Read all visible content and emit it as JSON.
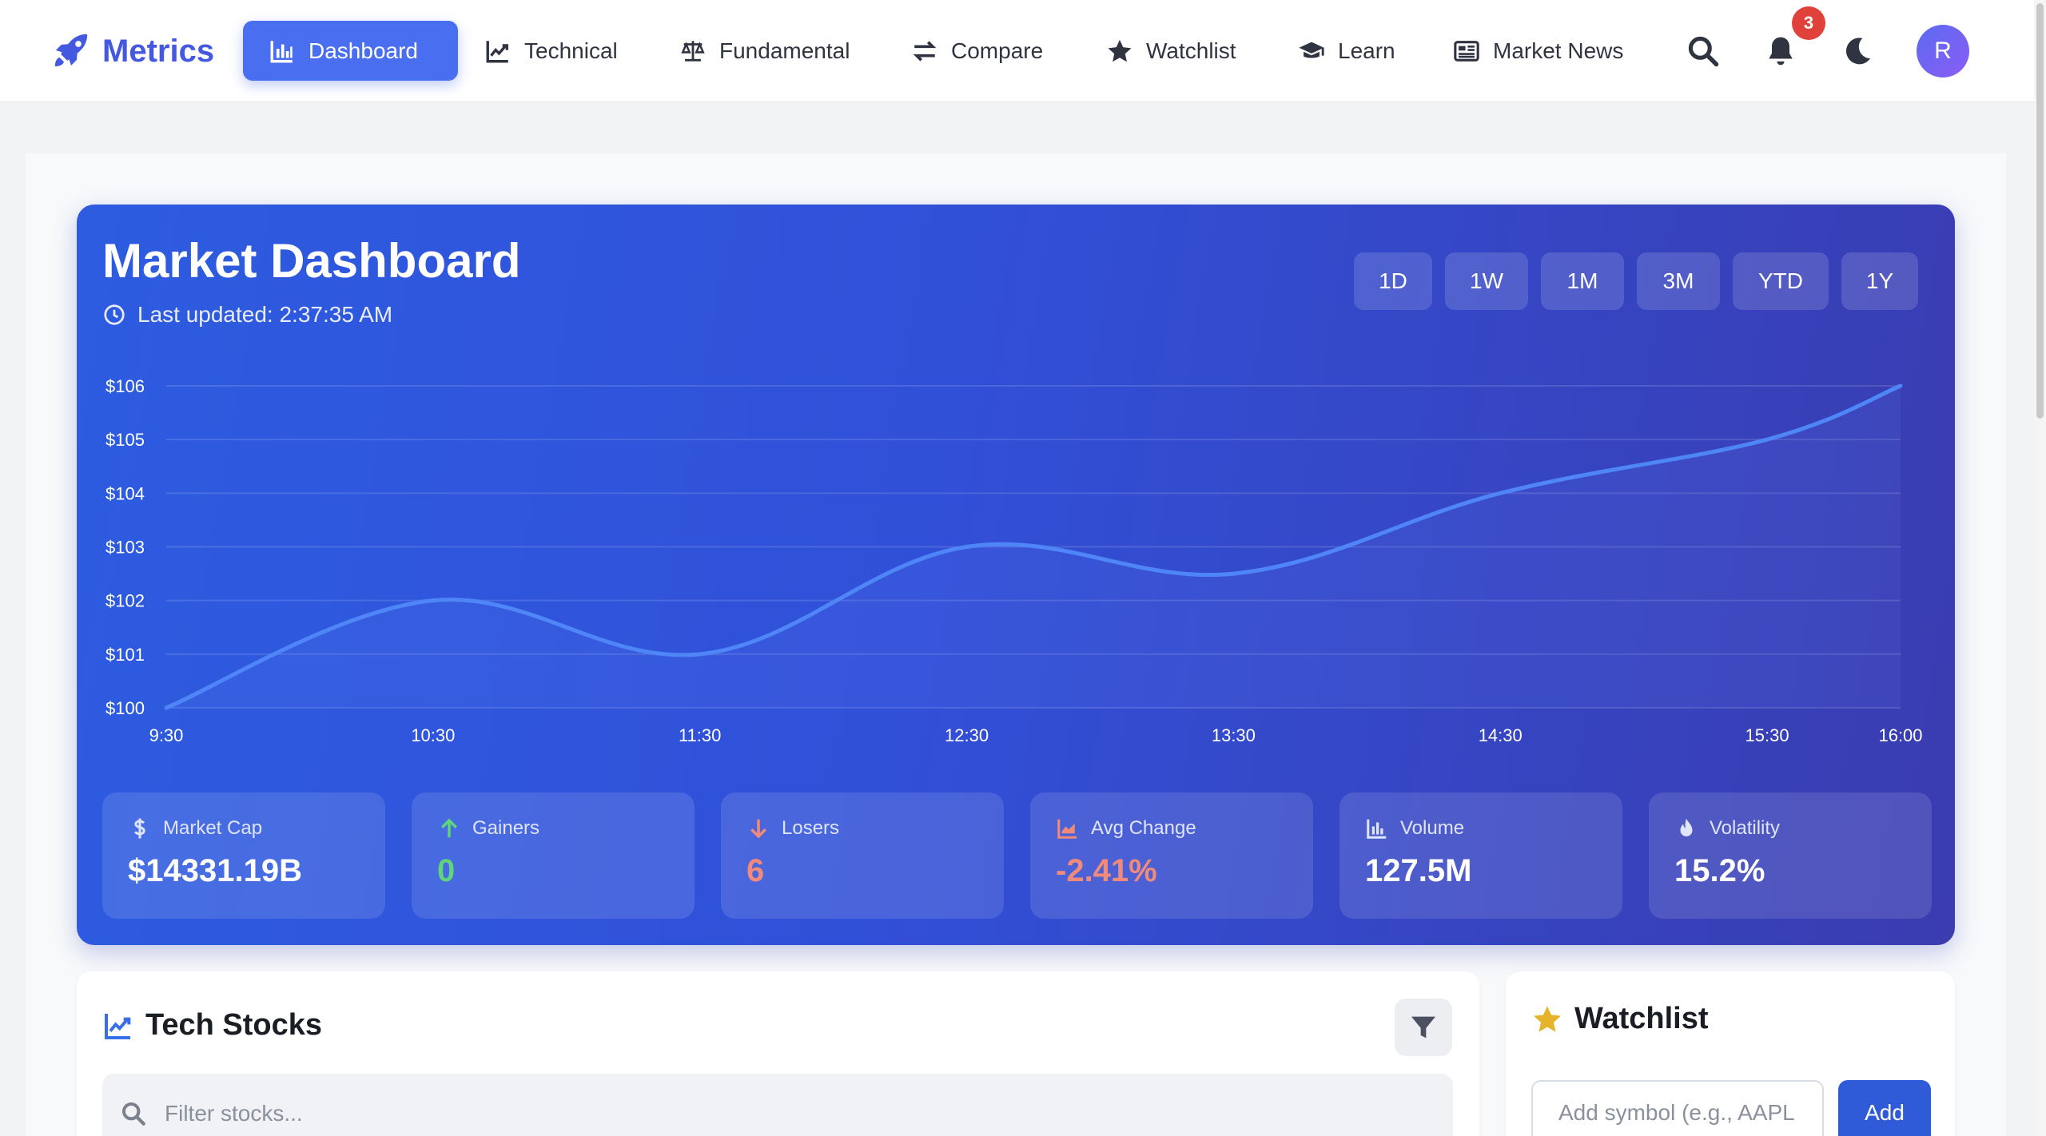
{
  "nav": {
    "brand": "Metrics",
    "items": [
      {
        "label": "Dashboard",
        "icon": "bar-chart-icon"
      },
      {
        "label": "Technical",
        "icon": "line-chart-icon"
      },
      {
        "label": "Fundamental",
        "icon": "balance-scale-icon"
      },
      {
        "label": "Compare",
        "icon": "exchange-icon"
      },
      {
        "label": "Watchlist",
        "icon": "star-icon"
      },
      {
        "label": "Learn",
        "icon": "graduation-cap-icon"
      },
      {
        "label": "Market News",
        "icon": "newspaper-icon"
      }
    ],
    "notification_count": "3",
    "avatar_initial": "R"
  },
  "hero": {
    "title": "Market Dashboard",
    "updated": "Last updated: 2:37:35 AM",
    "ranges": [
      "1D",
      "1W",
      "1M",
      "3M",
      "YTD",
      "1Y"
    ]
  },
  "chart_data": {
    "type": "line",
    "x": [
      "9:30",
      "10:30",
      "11:30",
      "12:30",
      "13:30",
      "14:30",
      "15:30",
      "16:00"
    ],
    "series": [
      {
        "values": [
          100,
          102,
          101,
          103,
          102.5,
          104,
          105,
          106
        ]
      }
    ],
    "yticks": [
      "$106",
      "$105",
      "$104",
      "$103",
      "$102",
      "$101",
      "$100"
    ],
    "ylim": [
      100,
      106
    ],
    "grid": true
  },
  "stats": [
    {
      "label": "Market Cap",
      "value": "$14331.19B",
      "icon": "dollar-icon"
    },
    {
      "label": "Gainers",
      "value": "0",
      "icon": "arrow-up-icon"
    },
    {
      "label": "Losers",
      "value": "6",
      "icon": "arrow-down-icon"
    },
    {
      "label": "Avg Change",
      "value": "-2.41%",
      "icon": "area-chart-icon"
    },
    {
      "label": "Volume",
      "value": "127.5M",
      "icon": "bar-chart-icon"
    },
    {
      "label": "Volatility",
      "value": "15.2%",
      "icon": "fire-icon"
    }
  ],
  "tech_stocks": {
    "title": "Tech Stocks",
    "filter_placeholder": "Filter stocks..."
  },
  "watchlist": {
    "title": "Watchlist",
    "input_placeholder": "Add symbol (e.g., AAPL",
    "add_label": "Add"
  },
  "colors": {
    "brand": "#4458e0",
    "active_nav": "#4a6ef0",
    "hero_start": "#2d5ce0",
    "hero_end": "#3a3cb0",
    "line": "#4f86f7",
    "positive": "#5fd47a",
    "negative": "#f08a7a",
    "badge": "#e0413a",
    "add_button": "#2f5bd8",
    "star": "#e6b32a"
  }
}
